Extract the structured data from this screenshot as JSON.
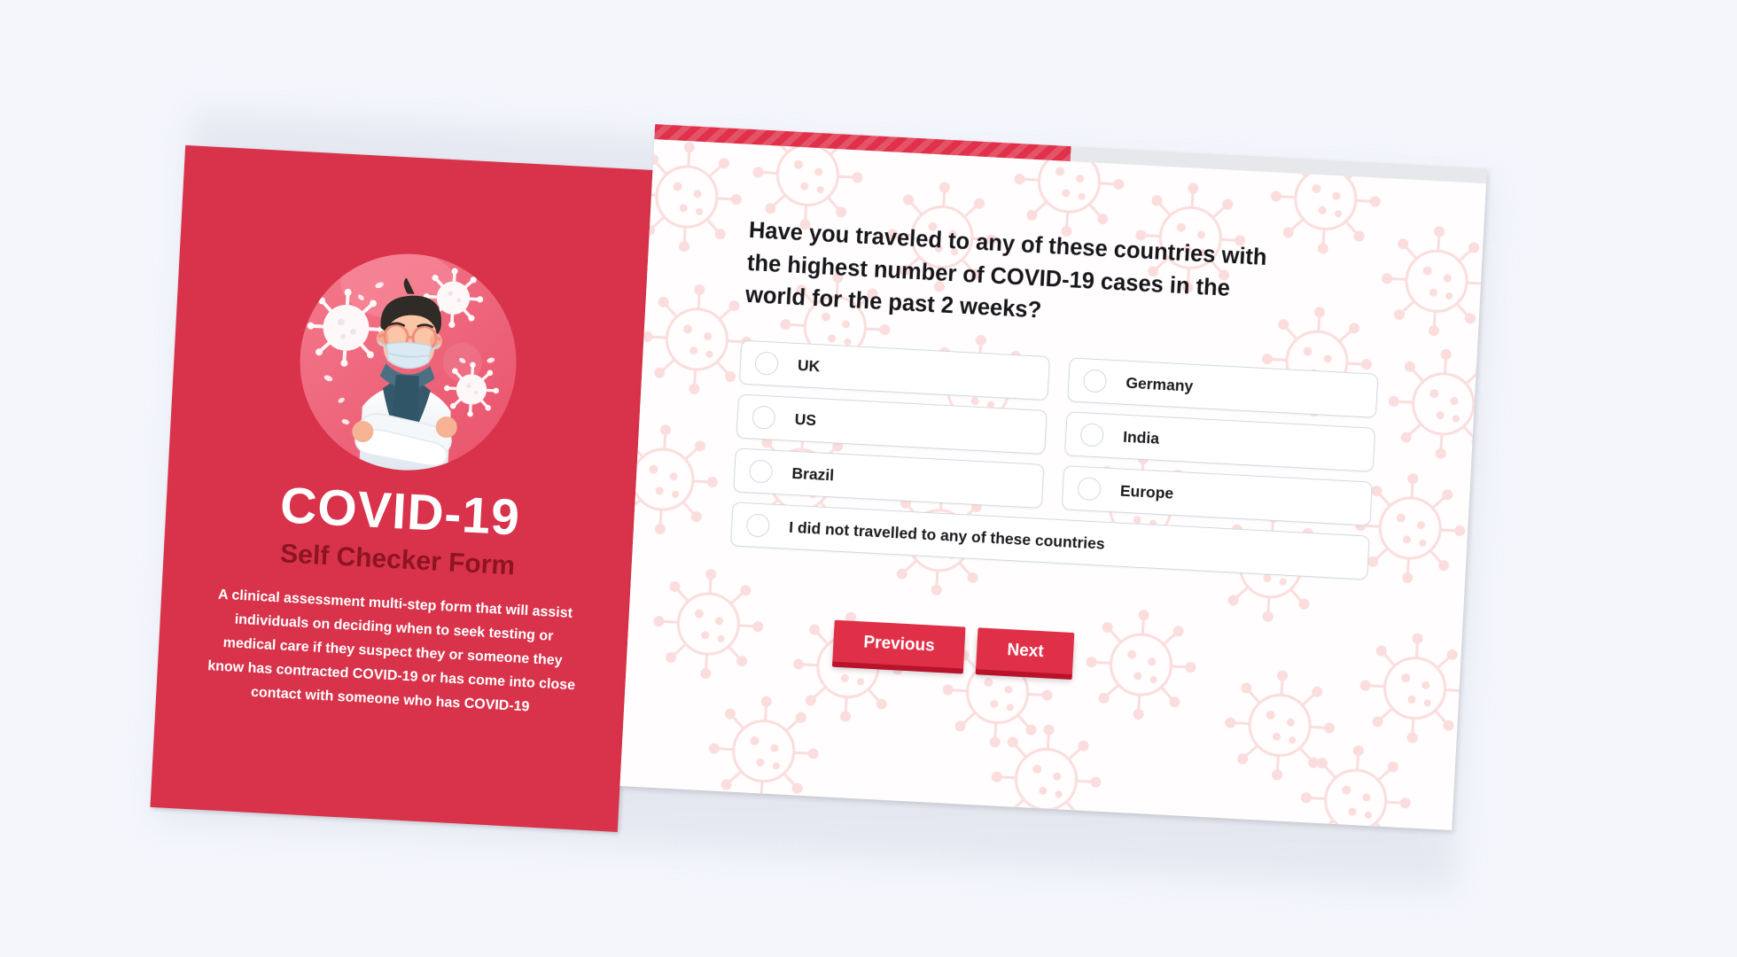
{
  "page": {
    "background_color": "#f4f6fc"
  },
  "card": {
    "left_panel": {
      "background_color": "#d8334a",
      "illustration": "doctor-with-mask-illustration",
      "title": "COVID-19",
      "subtitle": "Self Checker Form",
      "subtitle_color": "#8e1423",
      "description": "A clinical assessment multi-step form that will assist individuals on deciding when to seek testing or medical care if they suspect they or someone they know has contracted COVID-19 or has come into close contact with someone who has COVID-19"
    },
    "right_panel": {
      "background_color": "#fffdfd",
      "pattern": "coronavirus-pattern",
      "progress": {
        "percent": 50,
        "fill_color": "#e0304a",
        "track_color": "#e7e8ec"
      },
      "question": "Have you traveled to any of these countries with the highest number of COVID-19 cases in the world for the past 2 weeks?",
      "options": [
        {
          "label": "UK",
          "selected": false,
          "wide": false
        },
        {
          "label": "Germany",
          "selected": false,
          "wide": false
        },
        {
          "label": "US",
          "selected": false,
          "wide": false
        },
        {
          "label": "India",
          "selected": false,
          "wide": false
        },
        {
          "label": "Brazil",
          "selected": false,
          "wide": false
        },
        {
          "label": "Europe",
          "selected": false,
          "wide": false
        },
        {
          "label": "I did not travelled to any of these countries",
          "selected": false,
          "wide": true
        }
      ],
      "buttons": {
        "previous": "Previous",
        "next": "Next",
        "color": "#e03048",
        "shadow_color": "#b8132a"
      }
    }
  }
}
